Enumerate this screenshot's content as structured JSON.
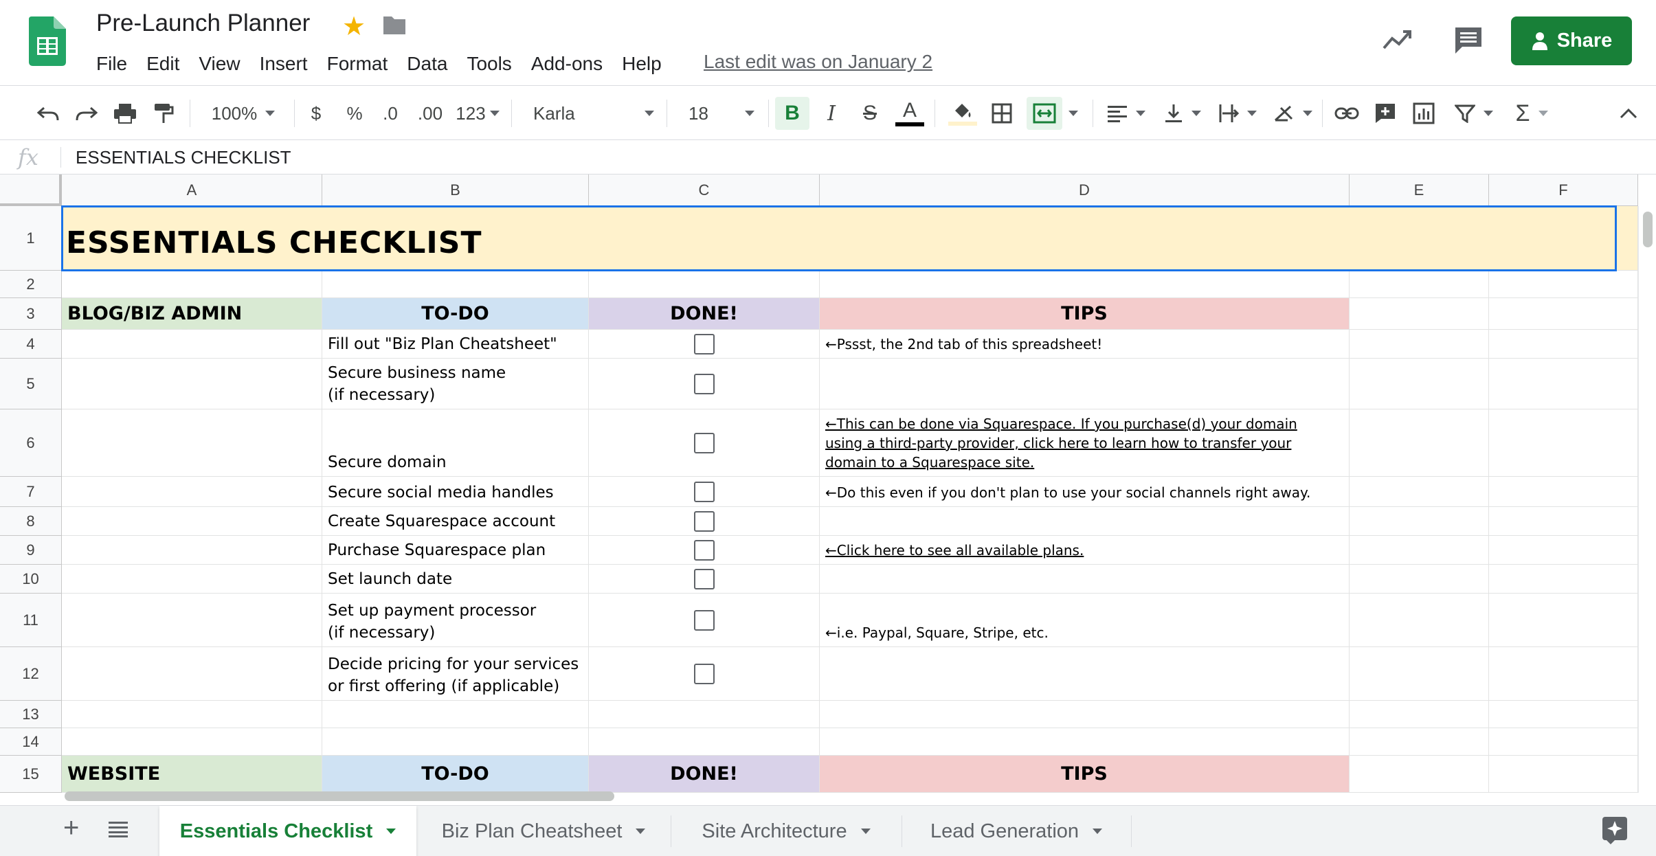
{
  "app": {
    "doc_title": "Pre-Launch Planner",
    "last_edit": "Last edit was on January 2",
    "share_label": "Share",
    "brand_color": "#188038"
  },
  "menu": [
    "File",
    "Edit",
    "View",
    "Insert",
    "Format",
    "Data",
    "Tools",
    "Add-ons",
    "Help"
  ],
  "toolbar": {
    "zoom": "100%",
    "currency": "$",
    "percent": "%",
    "decrease_decimal": ".0",
    "increase_decimal": ".00",
    "number_format": "123",
    "font": "Karla",
    "font_size": "18",
    "bold": "B",
    "italic": "I",
    "strike": "S",
    "text_color_glyph": "A"
  },
  "formula_bar": {
    "fx": "fx",
    "value": "ESSENTIALS CHECKLIST"
  },
  "grid": {
    "columns": [
      "A",
      "B",
      "C",
      "D",
      "E",
      "F"
    ],
    "rows": [
      "1",
      "2",
      "3",
      "4",
      "5",
      "6",
      "7",
      "8",
      "9",
      "10",
      "11",
      "12",
      "13",
      "14",
      "15"
    ],
    "title": "ESSENTIALS CHECKLIST",
    "sections": [
      {
        "name": "BLOG/BIZ ADMIN",
        "todo_header": "TO-DO",
        "done_header": "DONE!",
        "tips_header": "TIPS",
        "items": [
          {
            "todo": "Fill out \"Biz Plan Cheatsheet\"",
            "tip": "←Pssst, the 2nd tab of this spreadsheet!",
            "done": false
          },
          {
            "todo": "Secure business name\n(if necessary)",
            "tip": "",
            "done": false
          },
          {
            "todo": "Secure domain",
            "tip": "←This can be done via Squarespace. If you purchase(d) your domain\nusing a third-party provider, click here to learn how to transfer your\ndomain to a Squarespace site.",
            "done": false
          },
          {
            "todo": "Secure social media handles",
            "tip": "←Do this even if you don't plan to use your social channels right away.",
            "done": false
          },
          {
            "todo": "Create Squarespace account",
            "tip": "",
            "done": false
          },
          {
            "todo": "Purchase Squarespace plan",
            "tip": "←Click here to see all available plans.",
            "done": false
          },
          {
            "todo": "Set launch date",
            "tip": "",
            "done": false
          },
          {
            "todo": "Set up payment processor\n(if necessary)",
            "tip": "←i.e. Paypal, Square, Stripe, etc.",
            "done": false
          },
          {
            "todo": "Decide pricing for your services\nor first offering (if applicable)",
            "tip": "",
            "done": false
          }
        ]
      },
      {
        "name": "WEBSITE",
        "todo_header": "TO-DO",
        "done_header": "DONE!",
        "tips_header": "TIPS"
      }
    ],
    "colors": {
      "title_bg": "#fff2cc",
      "section_bg": "#d9ead3",
      "todo_bg": "#cfe2f3",
      "done_bg": "#d9d2e9",
      "tips_bg": "#f4cccc"
    }
  },
  "sheets": {
    "tabs": [
      "Essentials Checklist",
      "Biz Plan Cheatsheet",
      "Site Architecture",
      "Lead Generation"
    ],
    "active": "Essentials Checklist"
  },
  "icons": [
    "sheets-logo-icon",
    "star-icon",
    "folder-icon",
    "trending-icon",
    "comment-icon",
    "person-icon",
    "undo-icon",
    "redo-icon",
    "print-icon",
    "paint-format-icon",
    "fill-color-icon",
    "borders-icon",
    "merge-icon",
    "align-icon",
    "valign-icon",
    "wrap-icon",
    "rotate-icon",
    "link-icon",
    "add-comment-icon",
    "insert-chart-icon",
    "filter-icon",
    "sigma-icon",
    "collapse-icon",
    "add-sheet-icon",
    "all-sheets-icon",
    "explore-icon"
  ]
}
